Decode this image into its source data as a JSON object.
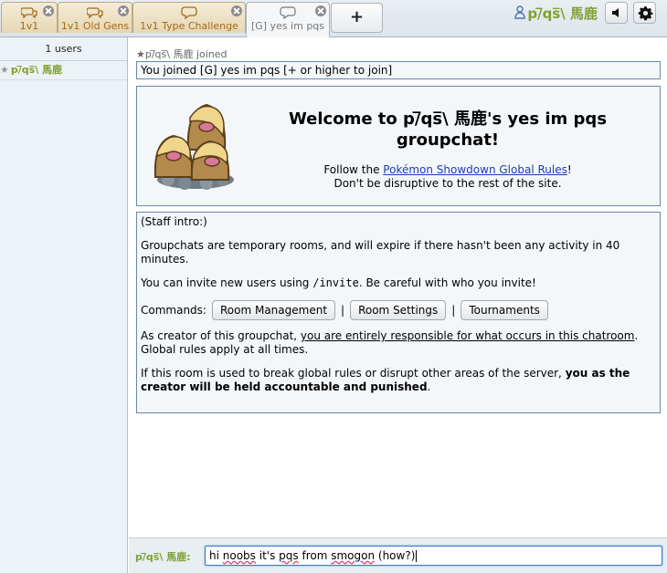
{
  "tabs": [
    {
      "label": "1v1"
    },
    {
      "label": "1v1 Old Gens"
    },
    {
      "label": "1v1 Type Challenge"
    },
    {
      "label": "[G] yes im pqs"
    }
  ],
  "new_tab_label": "+",
  "user": {
    "name": "p/̅qs̅\\ 馬鹿"
  },
  "userlist": {
    "count": "1 users",
    "users": [
      {
        "rank": "★",
        "name": "p/̅qs̅\\ 馬鹿"
      }
    ]
  },
  "chat": {
    "notice": "★p/̅qs̅\\ 馬鹿 joined",
    "joined": "You joined [G] yes im pqs [+ or higher to join]",
    "welcome": {
      "title_line1": "Welcome to p/̅qs̅\\ 馬鹿's yes im pqs",
      "title_line2": "groupchat!",
      "follow_pre": "Follow the ",
      "rules_link": "Pokémon Showdown Global Rules",
      "follow_post": "!",
      "disrupt": "Don't be disruptive to the rest of the site."
    },
    "intro": {
      "staff": "(Staff intro:)",
      "temp": "Groupchats are temporary rooms, and will expire if there hasn't been any activity in 40 minutes.",
      "invite_pre": "You can invite new users using ",
      "invite_cmd": "/invite",
      "invite_post": ". Be careful with who you invite!",
      "commands_label": "Commands:",
      "buttons": [
        "Room Management",
        "Room Settings",
        "Tournaments"
      ],
      "sep": "|",
      "creator_pre": "As creator of this groupchat, ",
      "creator_u": "you are entirely responsible for what occurs in this chatroom",
      "creator_post": ". Global rules apply at all times.",
      "break_pre": "If this room is used to break global rules or disrupt other areas of the server, ",
      "break_bold": "you as the creator will be held accountable and punished",
      "break_post": "."
    }
  },
  "composer": {
    "name": "p/̅qs̅\\ 馬鹿:",
    "words": [
      "hi ",
      "noobs",
      " it's ",
      "pqs",
      " from ",
      "smogon",
      " (how?)"
    ]
  },
  "colors": {
    "accent_name": "#7fa131",
    "tab_text": "#a36b16",
    "link": "#1a3eb1",
    "box_border": "#6688aa"
  }
}
